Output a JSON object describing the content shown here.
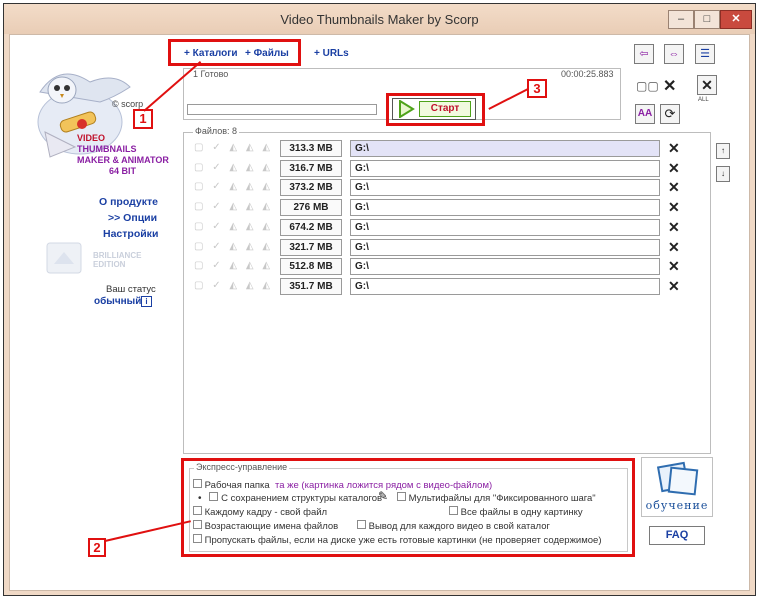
{
  "window": {
    "title": "Video Thumbnails Maker by Scorp",
    "min_label": "–",
    "max_label": "□",
    "close_label": "✕"
  },
  "logo": {
    "copyright": "© scorp",
    "name_line1": "VIDEO",
    "name_line2": "THUMBNAILS",
    "name_line3a": "MAKER & ",
    "name_line3b": "ANIMATOR",
    "bits": "64 BIT"
  },
  "side_menu": {
    "about": "О продукте",
    "options": ">> Опции",
    "settings": "Настройки"
  },
  "edition": {
    "line1": "BRILLIANCE",
    "line2": "EDITION"
  },
  "status": {
    "label": "Ваш статус",
    "value": "обычный",
    "info_icon": "i"
  },
  "source_tabs": {
    "catalogs": "+ Каталоги",
    "files": "+ Файлы",
    "urls": "+ URLs"
  },
  "progress": {
    "status_text": "1 Готово",
    "elapsed": "00:00:25.883",
    "start_label": "Старт",
    "fraction": 0
  },
  "toolbar": {
    "all_label": "ALL"
  },
  "files": {
    "header": "Файлов: 8",
    "rows": [
      {
        "size": "313.3 MB",
        "path": "G:\\"
      },
      {
        "size": "316.7 MB",
        "path": "G:\\"
      },
      {
        "size": "373.2 MB",
        "path": "G:\\"
      },
      {
        "size": "276 MB",
        "path": "G:\\"
      },
      {
        "size": "674.2 MB",
        "path": "G:\\"
      },
      {
        "size": "321.7 MB",
        "path": "G:\\"
      },
      {
        "size": "512.8 MB",
        "path": "G:\\"
      },
      {
        "size": "351.7 MB",
        "path": "G:\\"
      }
    ]
  },
  "express": {
    "title": "Экспресс-управление",
    "work_folder_label": "Рабочая папка",
    "work_folder_value": "та же (картинка ложится рядом с видео-файлом)",
    "keep_structure": "С сохранением структуры каталогов",
    "multifiles": "Мультифайлы для \"Фиксированного шага\"",
    "each_frame": "Каждому кадру - свой файл",
    "all_in_one": "Все файлы в одну картинку",
    "ascending": "Возрастающие имена файлов",
    "own_folder": "Вывод для каждого видео в свой каталог",
    "skip_existing": "Пропускать файлы, если на диске уже есть готовые картинки (не проверяет содержимое)"
  },
  "help": {
    "training_label": "обучение",
    "faq_label": "FAQ"
  },
  "annotations": {
    "one": "1",
    "two": "2",
    "three": "3"
  },
  "colors": {
    "annotation_red": "#e01010",
    "link_blue": "#1a3fa3",
    "accent_purple": "#8a1fa3",
    "logo_red": "#c0102a"
  }
}
